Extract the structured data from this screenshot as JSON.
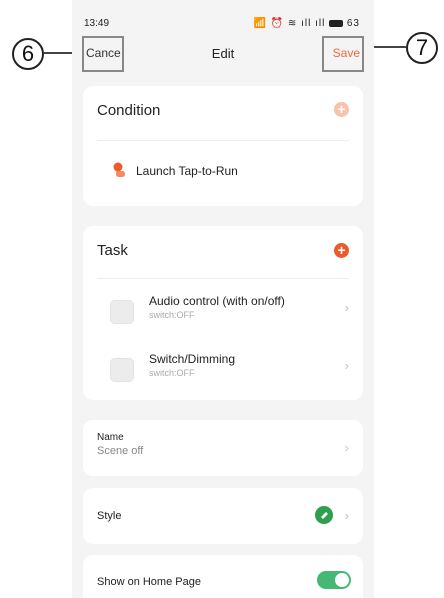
{
  "status_bar": {
    "time": "13:49",
    "icons_text": "📶 ⏰ ≋ ıll ıll",
    "battery": "63"
  },
  "nav": {
    "cancel_label": "Cance",
    "title": "Edit",
    "save_label": "Save"
  },
  "condition": {
    "title": "Condition",
    "item_label": "Launch Tap-to-Run",
    "add_icon": "plus-icon",
    "add_color": "#f7c3ad"
  },
  "task": {
    "title": "Task",
    "add_icon": "plus-icon",
    "add_color": "#ef5a2a",
    "items": [
      {
        "label": "Audio control (with on/off)",
        "sub": "switch:OFF"
      },
      {
        "label": "Switch/Dimming",
        "sub": "switch:OFF"
      }
    ]
  },
  "name_row": {
    "label": "Name",
    "value": "Scene off"
  },
  "style_row": {
    "label": "Style",
    "icon": "tag-icon",
    "color": "#2e9e4f"
  },
  "home_row": {
    "label": "Show on Home Page",
    "toggle_on": true,
    "toggle_color": "#45b873"
  },
  "annotations": {
    "left": "6",
    "right": "7"
  }
}
